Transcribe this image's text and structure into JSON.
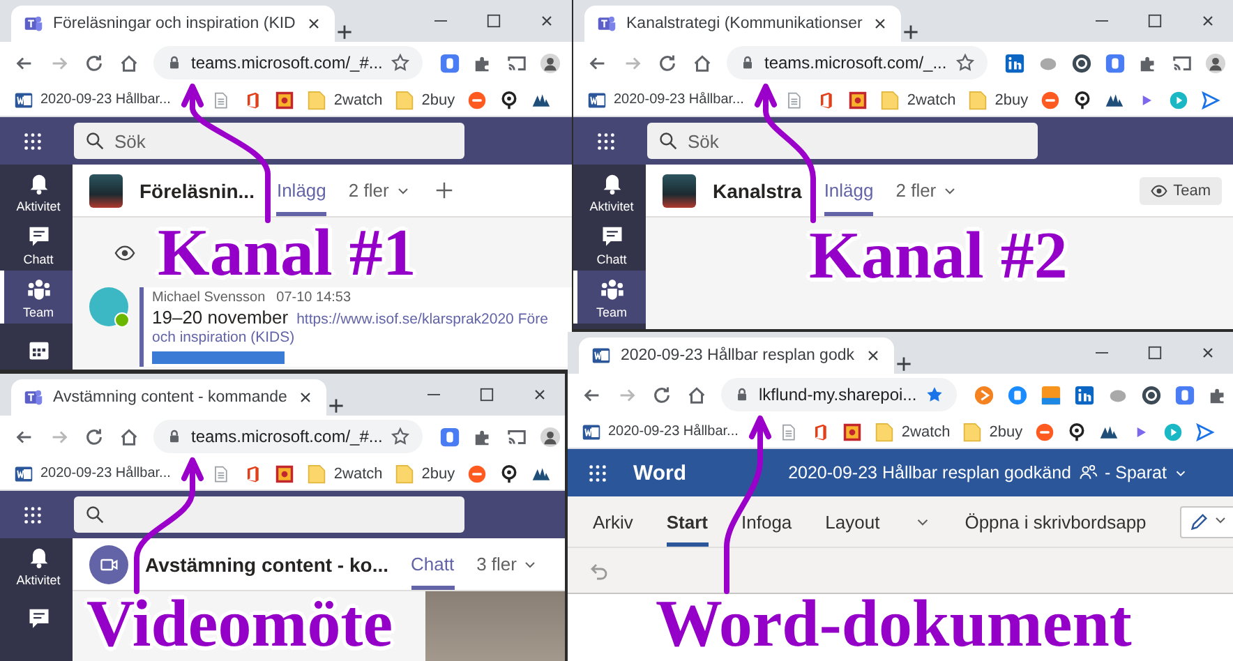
{
  "windows": [
    {
      "kind": "teams",
      "tab_title": "Föreläsningar och inspiration (KID",
      "url": "teams.microsoft.com/_#...",
      "bookmarked": false,
      "bookmarks": [
        "2020-09-23 Hållbar...",
        "2watch",
        "2buy"
      ],
      "search_placeholder": "Sök",
      "rail": [
        {
          "kind": "activity",
          "label": "Aktivitet",
          "selected": false
        },
        {
          "kind": "chat",
          "label": "Chatt",
          "selected": false
        },
        {
          "kind": "team",
          "label": "Team",
          "selected": true
        },
        {
          "kind": "calendar",
          "selected": false
        }
      ],
      "channel": {
        "title": "Föreläsnin...",
        "tabs": [
          {
            "kind": "tab",
            "label": "Inlägg",
            "selected": true
          },
          {
            "kind": "more",
            "label": "2 fler",
            "selected": false
          }
        ],
        "add_tab": true
      },
      "post": {
        "author": "Michael Svensson",
        "time": "07-10 14:53",
        "text": "19–20 november",
        "link_lines": [
          "https://www.isof.se/klarsprak2020 Före",
          "och inspiration (KIDS)"
        ]
      }
    },
    {
      "kind": "teams",
      "tab_title": "Avstämning content - kommande",
      "url": "teams.microsoft.com/_#...",
      "bookmarked": false,
      "bookmarks": [
        "2020-09-23 Hållbar...",
        "2watch",
        "2buy"
      ],
      "rail": [
        {
          "kind": "activity",
          "label": "Aktivitet",
          "selected": false
        },
        {
          "kind": "chat",
          "selected": false
        }
      ],
      "channel": {
        "title": "Avstämning content - ko...",
        "tabs": [
          {
            "kind": "tab",
            "label": "Chatt",
            "selected": true
          },
          {
            "kind": "more",
            "label": "3 fler",
            "selected": false
          }
        ]
      },
      "video": true
    },
    {
      "kind": "teams",
      "tab_title": "Kanalstrategi (Kommunikationser",
      "url": "teams.microsoft.com/_...",
      "bookmarked": false,
      "bookmarks": [
        "2020-09-23 Hållbar...",
        "2watch",
        "2buy"
      ],
      "search_placeholder": "Sök",
      "rail": [
        {
          "kind": "activity",
          "label": "Aktivitet",
          "selected": false
        },
        {
          "kind": "chat",
          "label": "Chatt",
          "selected": false
        },
        {
          "kind": "team",
          "label": "Team",
          "selected": true
        }
      ],
      "channel": {
        "title": "Kanalstra",
        "tabs": [
          {
            "kind": "tab",
            "label": "Inlägg",
            "selected": true
          },
          {
            "kind": "more",
            "label": "2 fler",
            "selected": false
          }
        ],
        "team_button": "Team"
      }
    },
    {
      "kind": "word",
      "tab_title": "2020-09-23 Hållbar resplan godk",
      "url": "lkflund-my.sharepoi...",
      "bookmarked": true,
      "bookmarks": [
        "2020-09-23 Hållbar...",
        "2watch",
        "2buy"
      ],
      "word": {
        "app": "Word",
        "doc_title": "2020-09-23 Hållbar resplan godkänd",
        "save_status": "- Sparat",
        "ribbon_tabs": [
          {
            "label": "Arkiv",
            "selected": false
          },
          {
            "label": "Start",
            "selected": true
          },
          {
            "label": "Infoga",
            "selected": false
          },
          {
            "label": "Layout",
            "selected": false
          }
        ],
        "open_desktop": "Öppna i skrivbordsapp"
      }
    }
  ],
  "annotations": [
    "Kanal #1",
    "Kanal #2",
    "Videomöte",
    "Word-dokument"
  ]
}
